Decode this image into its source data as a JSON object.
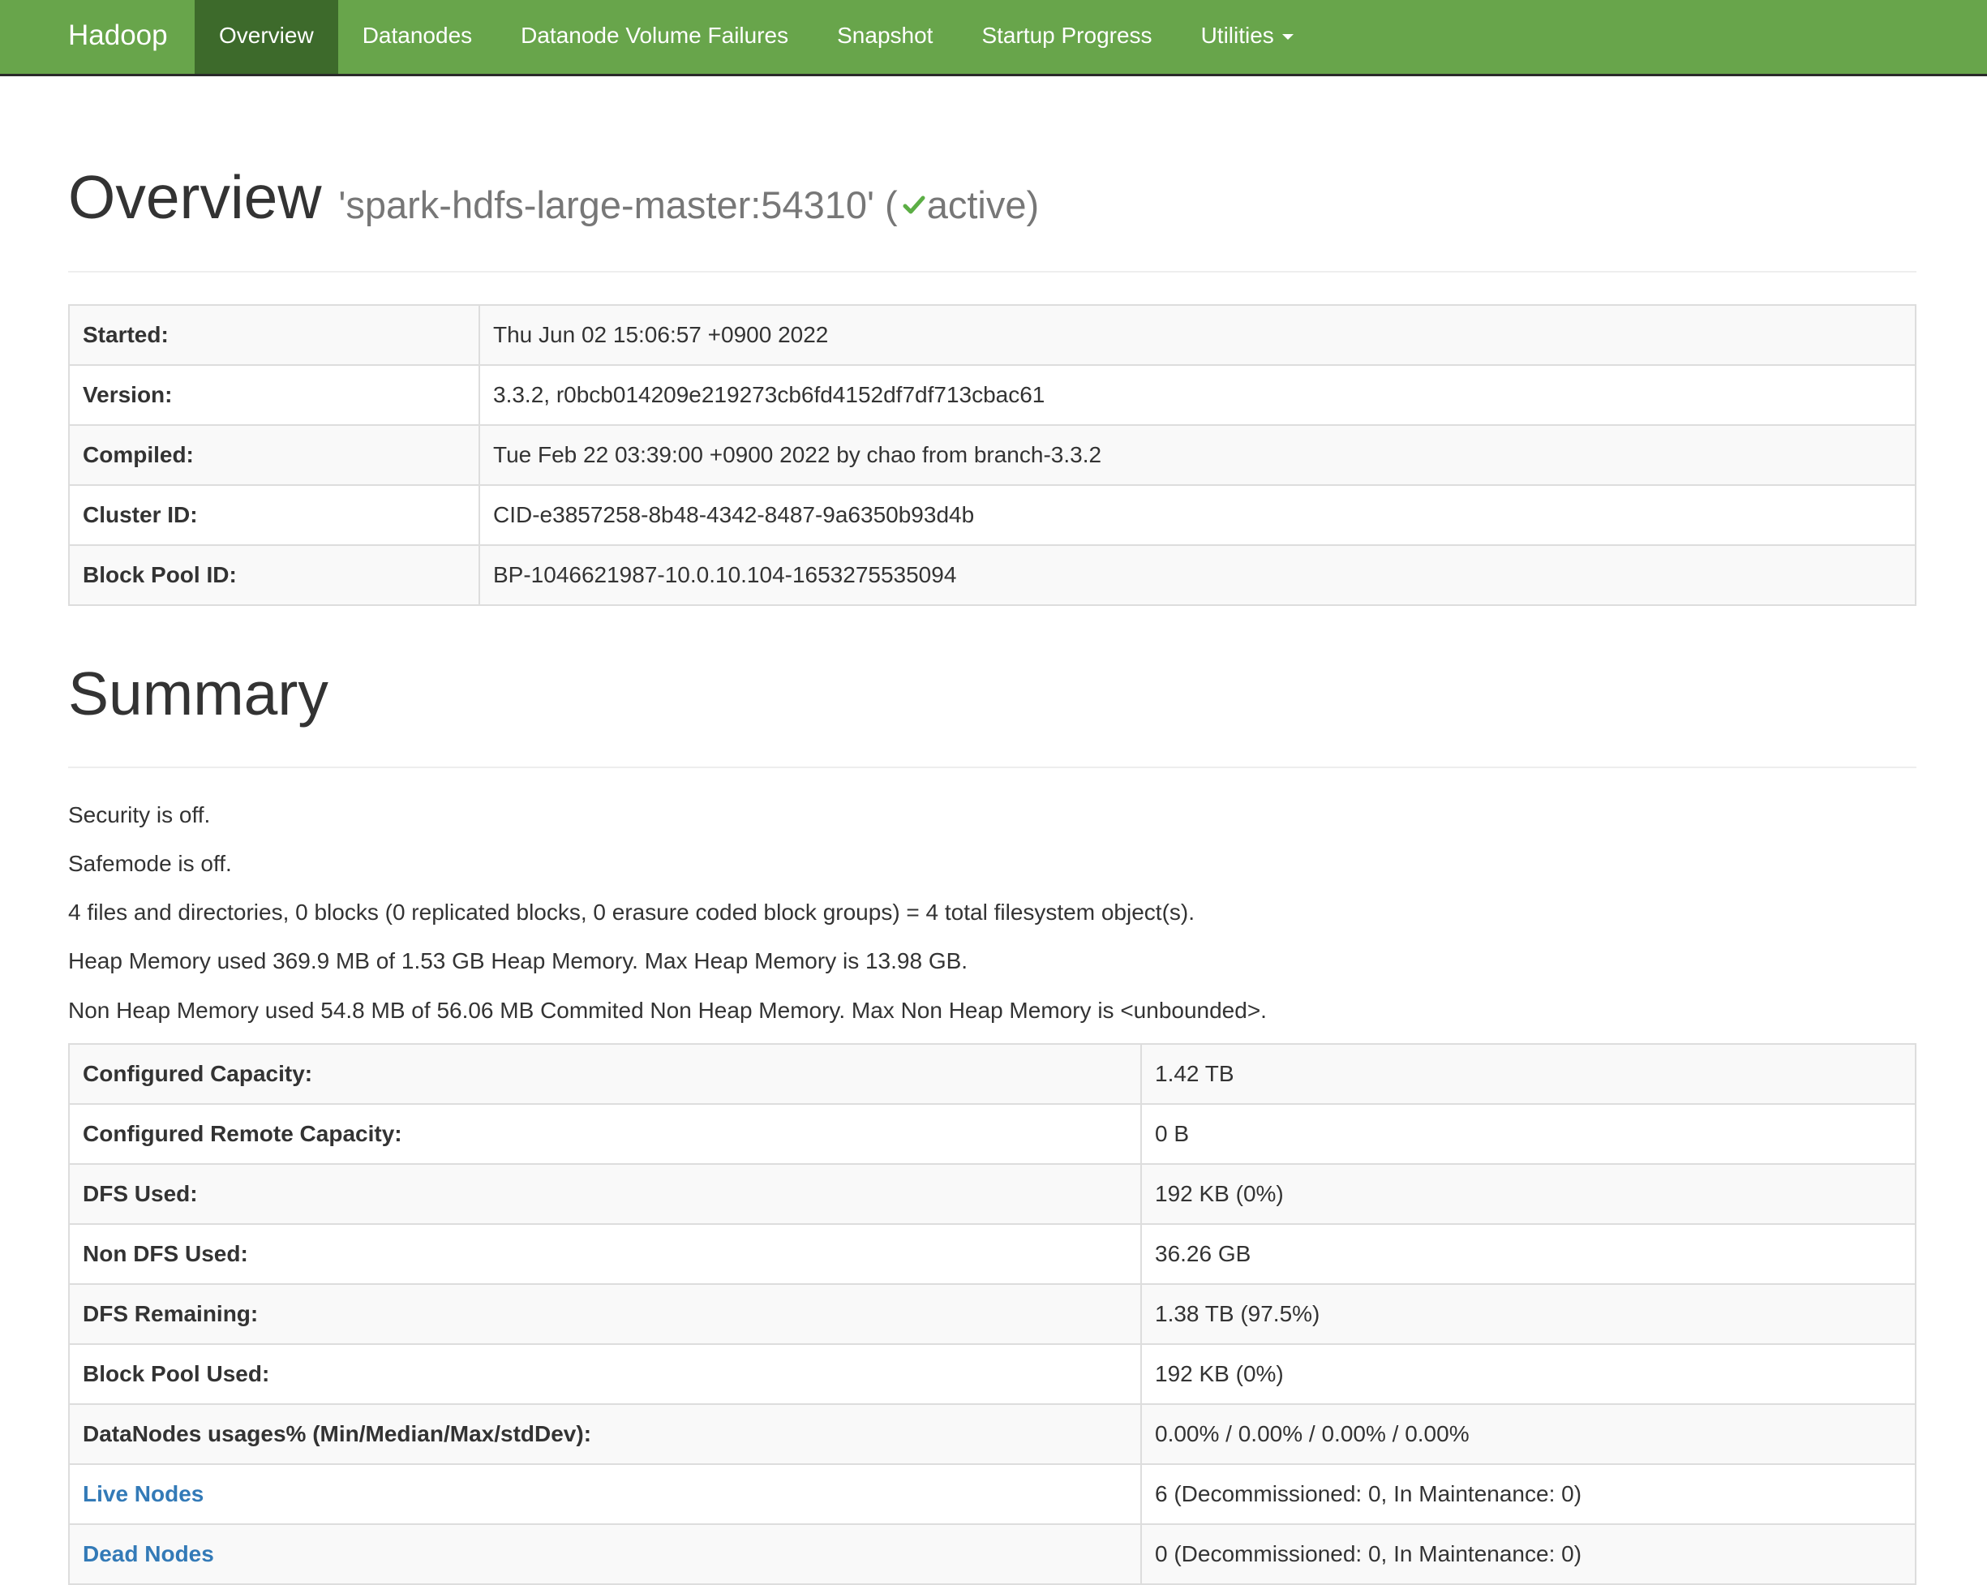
{
  "navbar": {
    "brand": "Hadoop",
    "items": [
      {
        "label": "Overview"
      },
      {
        "label": "Datanodes"
      },
      {
        "label": "Datanode Volume Failures"
      },
      {
        "label": "Snapshot"
      },
      {
        "label": "Startup Progress"
      },
      {
        "label": "Utilities"
      }
    ]
  },
  "overview": {
    "title": "Overview",
    "host": "'spark-hdfs-large-master:54310'",
    "open_paren": "(",
    "state": "active)",
    "rows": [
      {
        "key": "Started:",
        "value": "Thu Jun 02 15:06:57 +0900 2022"
      },
      {
        "key": "Version:",
        "value": "3.3.2, r0bcb014209e219273cb6fd4152df7df713cbac61"
      },
      {
        "key": "Compiled:",
        "value": "Tue Feb 22 03:39:00 +0900 2022 by chao from branch-3.3.2"
      },
      {
        "key": "Cluster ID:",
        "value": "CID-e3857258-8b48-4342-8487-9a6350b93d4b"
      },
      {
        "key": "Block Pool ID:",
        "value": "BP-1046621987-10.0.10.104-1653275535094"
      }
    ]
  },
  "summary": {
    "title": "Summary",
    "lines": [
      "Security is off.",
      "Safemode is off.",
      "4 files and directories, 0 blocks (0 replicated blocks, 0 erasure coded block groups) = 4 total filesystem object(s).",
      "Heap Memory used 369.9 MB of 1.53 GB Heap Memory. Max Heap Memory is 13.98 GB.",
      "Non Heap Memory used 54.8 MB of 56.06 MB Commited Non Heap Memory. Max Non Heap Memory is <unbounded>."
    ],
    "rows": [
      {
        "key": "Configured Capacity:",
        "value": "1.42 TB"
      },
      {
        "key": "Configured Remote Capacity:",
        "value": "0 B"
      },
      {
        "key": "DFS Used:",
        "value": "192 KB (0%)"
      },
      {
        "key": "Non DFS Used:",
        "value": "36.26 GB"
      },
      {
        "key": "DFS Remaining:",
        "value": "1.38 TB (97.5%)"
      },
      {
        "key": "Block Pool Used:",
        "value": "192 KB (0%)"
      },
      {
        "key": "DataNodes usages% (Min/Median/Max/stdDev):",
        "value": "0.00% / 0.00% / 0.00% / 0.00%"
      },
      {
        "key": "Live Nodes",
        "value": "6 (Decommissioned: 0, In Maintenance: 0)"
      },
      {
        "key": "Dead Nodes",
        "value": "0 (Decommissioned: 0, In Maintenance: 0)"
      }
    ]
  },
  "colors": {
    "navbar": "#68a54b",
    "navbar_active": "#3d6a2b",
    "link": "#337ab7",
    "check": "#5cae45"
  }
}
